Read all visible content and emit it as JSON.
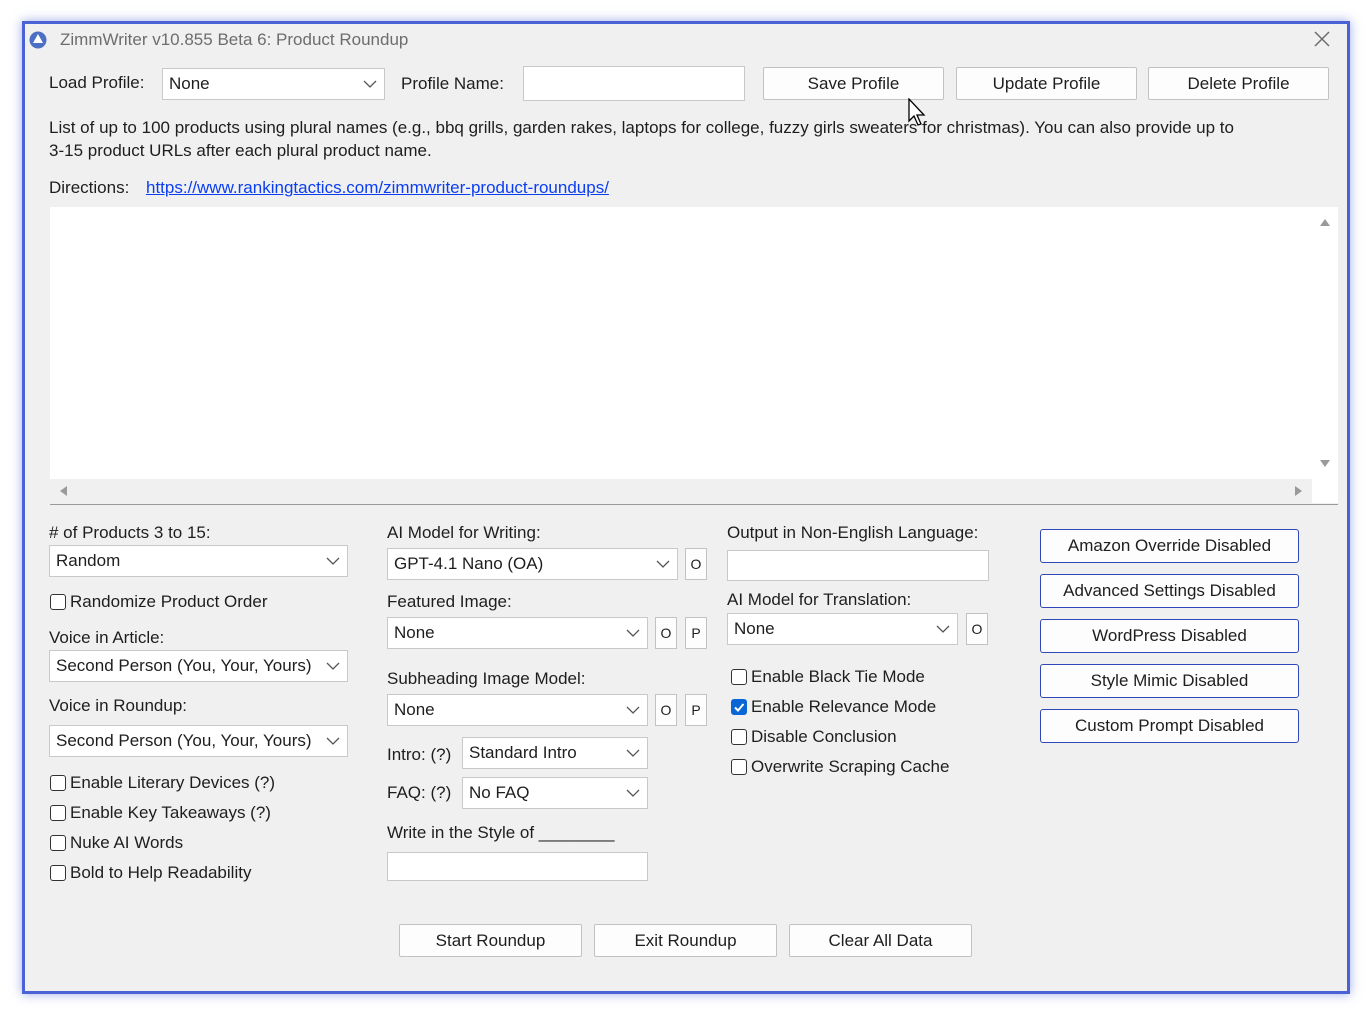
{
  "window": {
    "title": "ZimmWriter v10.855 Beta 6: Product Roundup"
  },
  "profile": {
    "load_label": "Load Profile:",
    "load_value": "None",
    "name_label": "Profile Name:",
    "name_value": "",
    "save": "Save Profile",
    "update": "Update Profile",
    "delete": "Delete Profile"
  },
  "instructions": {
    "line1": "List of up to 100 products using plural names (e.g., bbq grills, garden rakes, laptops for college, fuzzy girls sweaters for christmas). You can also provide up to",
    "line2": "3-15 product URLs after each plural product name.",
    "directions_label": "Directions:",
    "directions_link": "https://www.rankingtactics.com/zimmwriter-product-roundups/"
  },
  "products_input": {
    "value": ""
  },
  "col1": {
    "num_products_label": "# of Products 3 to 15:",
    "num_products_value": "Random",
    "randomize_order": {
      "label": "Randomize Product Order",
      "checked": false
    },
    "voice_article_label": "Voice in Article:",
    "voice_article_value": "Second Person (You, Your, Yours)",
    "voice_roundup_label": "Voice in Roundup:",
    "voice_roundup_value": "Second Person (You, Your, Yours)",
    "literary_devices": {
      "label": "Enable Literary Devices (?)",
      "checked": false
    },
    "key_takeaways": {
      "label": "Enable Key Takeaways (?)",
      "checked": false
    },
    "nuke_ai": {
      "label": "Nuke AI Words",
      "checked": false
    },
    "bold_readability": {
      "label": "Bold to Help Readability",
      "checked": false
    }
  },
  "col2": {
    "ai_model_label": "AI Model for Writing:",
    "ai_model_value": "GPT-4.1 Nano (OA)",
    "o_btn": "O",
    "p_btn": "P",
    "featured_image_label": "Featured Image:",
    "featured_image_value": "None",
    "subheading_image_label": "Subheading Image Model:",
    "subheading_image_value": "None",
    "intro_label": "Intro: (?)",
    "intro_value": "Standard Intro",
    "faq_label": "FAQ: (?)",
    "faq_value": "No FAQ",
    "style_label": "Write in the Style of ________",
    "style_value": ""
  },
  "col3": {
    "output_lang_label": "Output in Non-English Language:",
    "output_lang_value": "",
    "translation_label": "AI Model for Translation:",
    "translation_value": "None",
    "o_btn": "O",
    "black_tie": {
      "label": "Enable Black Tie Mode",
      "checked": false
    },
    "relevance": {
      "label": "Enable Relevance Mode",
      "checked": true
    },
    "disable_conclusion": {
      "label": "Disable Conclusion",
      "checked": false
    },
    "overwrite_cache": {
      "label": "Overwrite Scraping Cache",
      "checked": false
    }
  },
  "col4": {
    "amazon": "Amazon Override Disabled",
    "advanced": "Advanced Settings Disabled",
    "wordpress": "WordPress Disabled",
    "style_mimic": "Style Mimic Disabled",
    "custom_prompt": "Custom Prompt Disabled"
  },
  "actions": {
    "start": "Start Roundup",
    "exit": "Exit Roundup",
    "clear": "Clear All Data"
  },
  "colors": {
    "window_border": "#4a62d6",
    "link": "#0b3ef0",
    "checkbox_checked": "#0a66d6",
    "accent_button_border": "#2f47b8"
  }
}
